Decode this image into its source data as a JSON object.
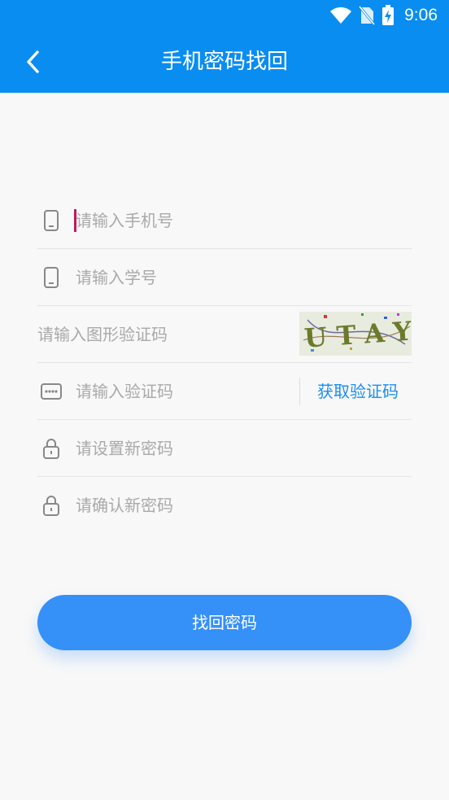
{
  "status_bar": {
    "time": "9:06"
  },
  "header": {
    "title": "手机密码找回"
  },
  "form": {
    "phone_placeholder": "请输入手机号",
    "student_id_placeholder": "请输入学号",
    "captcha_placeholder": "请输入图形验证码",
    "captcha_text": "UTAY",
    "sms_code_placeholder": "请输入验证码",
    "get_code_label": "获取验证码",
    "new_password_placeholder": "请设置新密码",
    "confirm_password_placeholder": "请确认新密码"
  },
  "actions": {
    "submit_label": "找回密码"
  },
  "colors": {
    "primary": "#0a8df0",
    "button": "#3590f8",
    "caret": "#c2185b"
  }
}
